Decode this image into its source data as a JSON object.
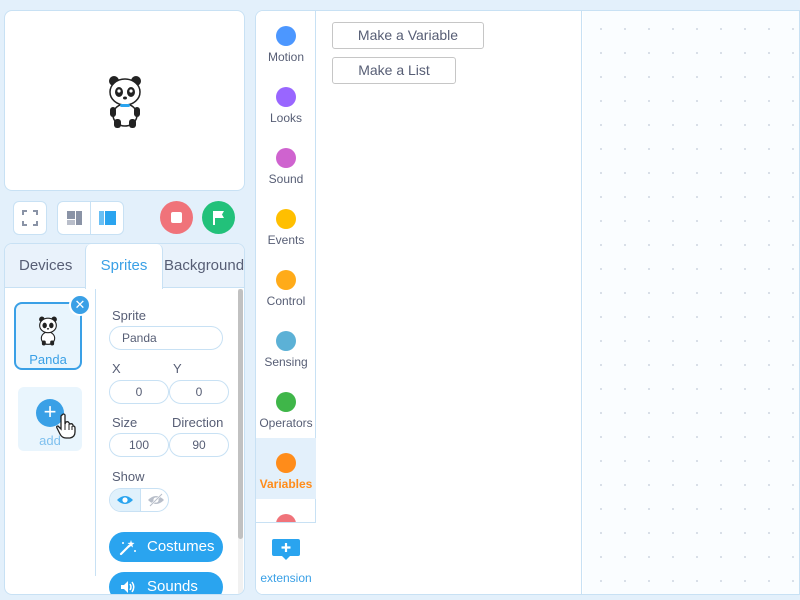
{
  "stage": {
    "sprite_icon": "panda-icon"
  },
  "controls": {
    "fullscreen_icon": "fullscreen-icon",
    "layout_small_icon": "small-stage-icon",
    "layout_large_icon": "large-stage-icon",
    "stop_icon": "stop-icon",
    "green_flag_icon": "flag-icon",
    "stop_color": "#f0737a",
    "flag_color": "#22c17a"
  },
  "tabs": {
    "devices": "Devices",
    "sprites": "Sprites",
    "background": "Background"
  },
  "sprite_list": {
    "items": [
      {
        "name": "Panda",
        "selected": true
      }
    ],
    "add_label": "add"
  },
  "sprite_props": {
    "sprite_label": "Sprite",
    "sprite_value": "Panda",
    "x_label": "X",
    "x_value": "0",
    "y_label": "Y",
    "y_value": "0",
    "size_label": "Size",
    "size_value": "100",
    "direction_label": "Direction",
    "direction_value": "90",
    "show_label": "Show",
    "costumes_label": "Costumes",
    "sounds_label": "Sounds"
  },
  "categories": [
    {
      "label": "Motion",
      "color": "#4c97ff"
    },
    {
      "label": "Looks",
      "color": "#9966ff"
    },
    {
      "label": "Sound",
      "color": "#cf63cf"
    },
    {
      "label": "Events",
      "color": "#ffbf00"
    },
    {
      "label": "Control",
      "color": "#ffab19"
    },
    {
      "label": "Sensing",
      "color": "#5cb1d6"
    },
    {
      "label": "Operators",
      "color": "#3fb649"
    },
    {
      "label": "Variables",
      "color": "#ff8c1a",
      "active": true
    }
  ],
  "extension_label": "extension",
  "palette": {
    "make_variable": "Make a Variable",
    "make_list": "Make a List"
  },
  "accent_color": "#3aa0e6"
}
